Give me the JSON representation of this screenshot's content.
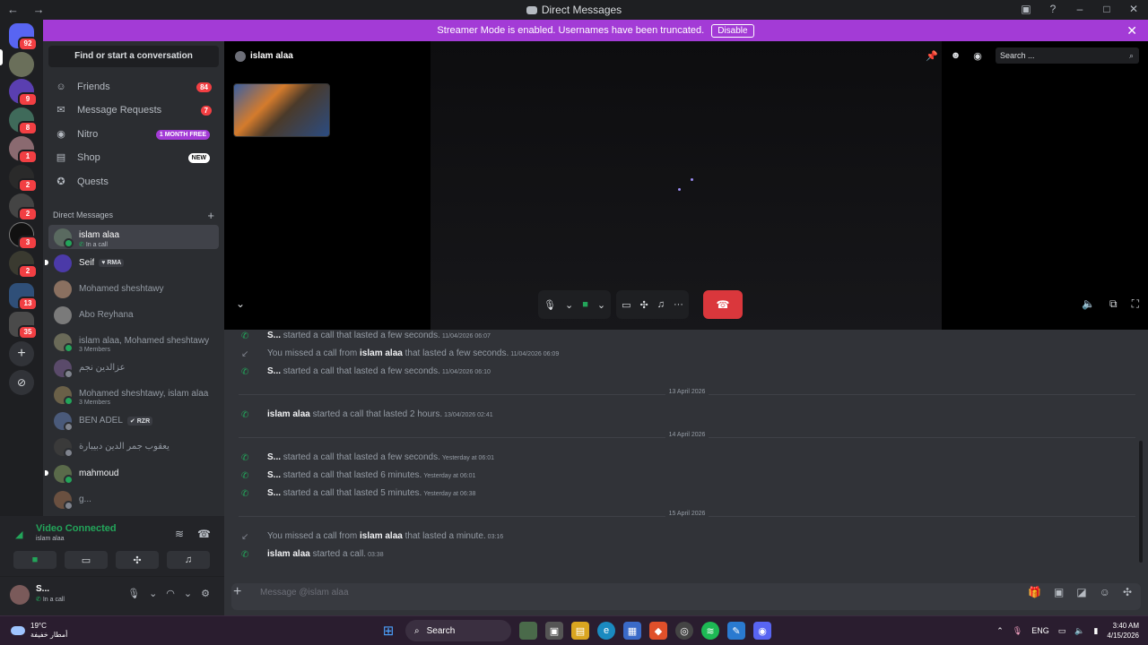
{
  "window": {
    "title": "Direct Messages",
    "nav_icons": "← →"
  },
  "streamer_banner": {
    "text": "Streamer Mode is enabled. Usernames have been truncated.",
    "button": "Disable"
  },
  "server_badges": [
    "92",
    "9",
    "8",
    "1",
    "2",
    "2",
    "3",
    "2",
    "13",
    "35"
  ],
  "sidebar": {
    "search_label": "Find or start a conversation",
    "nav": [
      {
        "label": "Friends",
        "count": "84"
      },
      {
        "label": "Message Requests",
        "count": "7"
      },
      {
        "label": "Nitro",
        "promo": "1 MONTH FREE"
      },
      {
        "label": "Shop",
        "promo": "NEW"
      },
      {
        "label": "Quests"
      }
    ],
    "dm_header": "Direct Messages",
    "dms": [
      {
        "name": "islam alaa",
        "sub": "In a call"
      },
      {
        "name": "Seif",
        "tag": "RMA"
      },
      {
        "name": "Mohamed sheshtawy"
      },
      {
        "name": "Abo Reyhana"
      },
      {
        "name": "islam alaa, Mohamed sheshtawy",
        "sub": "3 Members"
      },
      {
        "name": "عزالدين نجم"
      },
      {
        "name": "Mohamed sheshtawy, islam alaa",
        "sub": "3 Members"
      },
      {
        "name": "BEN ADEL",
        "tag": "RZR"
      },
      {
        "name": "يعقوب جمر الدين دبيبارة"
      },
      {
        "name": "mahmoud"
      },
      {
        "name": "g..."
      }
    ]
  },
  "voice_panel": {
    "status": "Video Connected",
    "channel": "islam alaa"
  },
  "user": {
    "name": "S...",
    "status": "In a call"
  },
  "call": {
    "title": "islam alaa",
    "search_placeholder": "Search ..."
  },
  "dividers": [
    "13 April 2026",
    "14 April 2026",
    "15 April 2026"
  ],
  "messages": [
    {
      "icon": "green",
      "pre": "",
      "who": "S...",
      "text": " started a call that lasted a few seconds.",
      "ts": "11/04/2026 06:07"
    },
    {
      "icon": "grey",
      "pre": "You missed a call from ",
      "who": "islam alaa",
      "text": " that lasted a few seconds.",
      "ts": "11/04/2026 06:09"
    },
    {
      "icon": "green",
      "pre": "",
      "who": "S...",
      "text": " started a call that lasted a few seconds.",
      "ts": "11/04/2026 06:10"
    },
    {
      "icon": "green",
      "pre": "",
      "who": "islam alaa",
      "text": " started a call that lasted 2 hours.",
      "ts": "13/04/2026 02:41"
    },
    {
      "icon": "green",
      "pre": "",
      "who": "S...",
      "text": " started a call that lasted a few seconds.",
      "ts": "Yesterday at 06:01"
    },
    {
      "icon": "green",
      "pre": "",
      "who": "S...",
      "text": " started a call that lasted 6 minutes.",
      "ts": "Yesterday at 06:01"
    },
    {
      "icon": "green",
      "pre": "",
      "who": "S...",
      "text": " started a call that lasted 5 minutes.",
      "ts": "Yesterday at 06:38"
    },
    {
      "icon": "grey",
      "pre": "You missed a call from ",
      "who": "islam alaa",
      "text": " that lasted a minute.",
      "ts": "03:16"
    },
    {
      "icon": "green",
      "pre": "",
      "who": "islam alaa",
      "text": " started a call.",
      "ts": "03:38"
    }
  ],
  "composer": {
    "placeholder": "Message @islam alaa"
  },
  "taskbar": {
    "temp": "19°C",
    "weather": "أمطار خفيفة",
    "search": "Search",
    "lang": "ENG",
    "time": "3:40 AM",
    "date": "4/15/2026"
  },
  "colors": {
    "banner": "#a33bd6",
    "online": "#23a55a",
    "hangup": "#da373c",
    "badge": "#f23f43"
  }
}
